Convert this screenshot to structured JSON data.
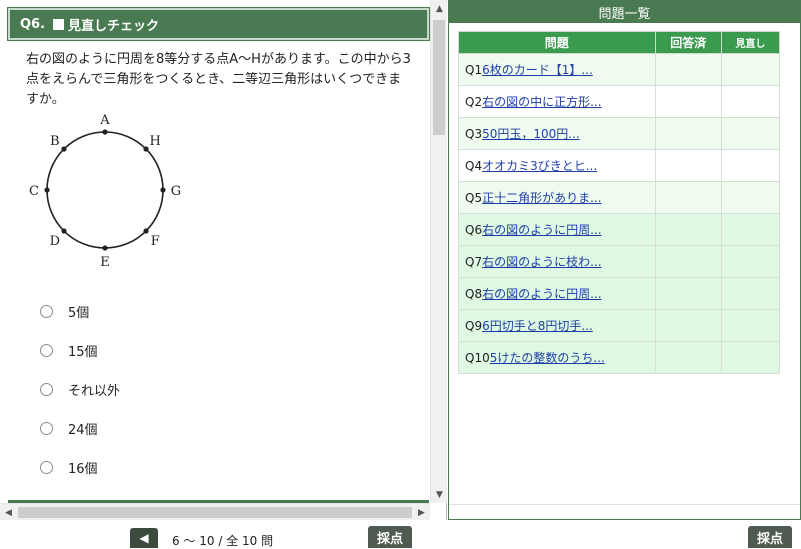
{
  "question": {
    "number": "Q6.",
    "check_label": "見直しチェック",
    "text": "右の図のように円周を8等分する点A〜Hがあります。この中から3点をえらんで三角形をつくるとき、二等辺三角形はいくつできますか。",
    "figure_labels": [
      "A",
      "B",
      "C",
      "D",
      "E",
      "F",
      "G",
      "H"
    ],
    "choices": [
      "5個",
      "15個",
      "それ以外",
      "24個",
      "16個"
    ]
  },
  "list": {
    "title": "問題一覧",
    "columns": [
      "問題",
      "回答済",
      "見直し"
    ],
    "rows": [
      {
        "no": "Q1",
        "title": "6枚のカード【1】..."
      },
      {
        "no": "Q2",
        "title": "右の図の中に正方形..."
      },
      {
        "no": "Q3",
        "title": "50円玉，100円..."
      },
      {
        "no": "Q4",
        "title": "オオカミ3びきとヒ..."
      },
      {
        "no": "Q5",
        "title": "正十二角形がありま..."
      },
      {
        "no": "Q6",
        "title": "右の図のように円周..."
      },
      {
        "no": "Q7",
        "title": "右の図のように枝わ..."
      },
      {
        "no": "Q8",
        "title": "右の図のように円周..."
      },
      {
        "no": "Q9",
        "title": "6円切手と8円切手..."
      },
      {
        "no": "Q10",
        "title": "5けたの整数のうち..."
      }
    ]
  },
  "footer": {
    "page_range": "6 〜 10 / 全 10 問",
    "score_label": "採点"
  },
  "colors": {
    "header_green": "#4a7a52",
    "table_header_green": "#3a9a4e",
    "link_blue": "#1f3fa8"
  },
  "icons": {
    "prev": "arrow-left-circle-icon"
  }
}
